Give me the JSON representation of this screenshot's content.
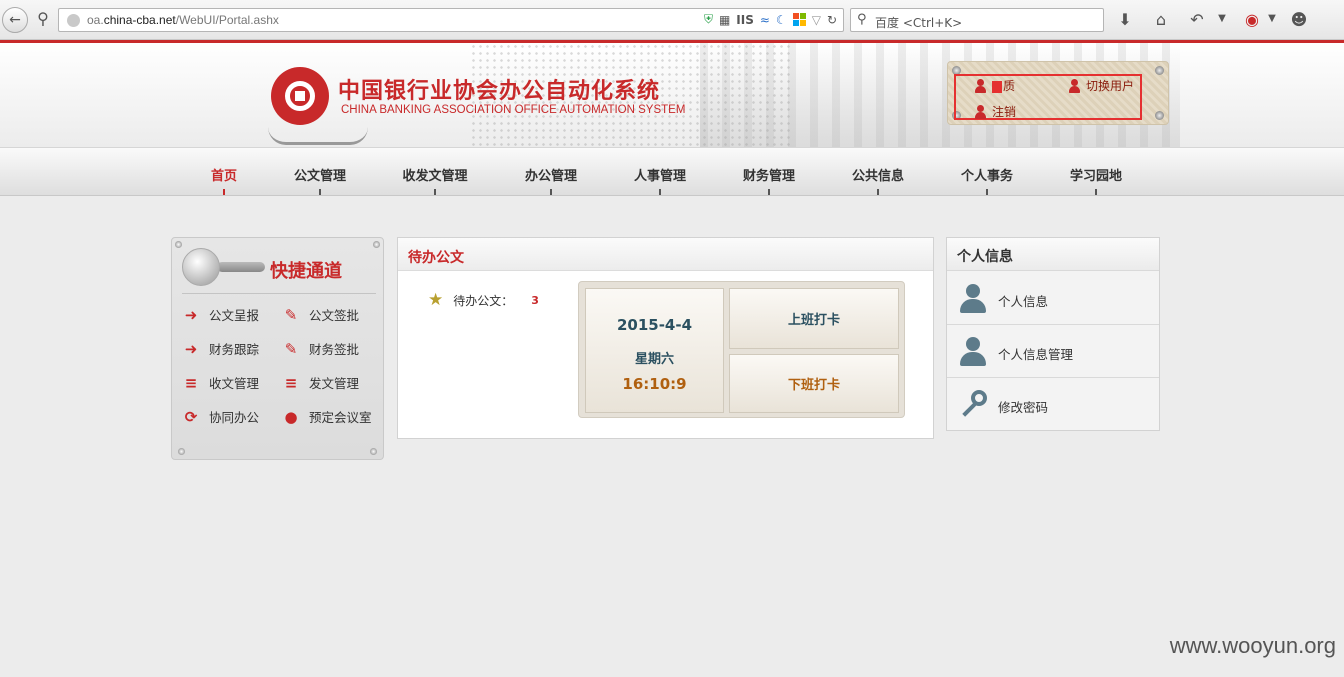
{
  "browser": {
    "url_prefix": "oa.",
    "url_domain": "china-cba.net",
    "url_path": "/WebUI/Portal.ashx",
    "search_placeholder": "百度 <Ctrl+K>",
    "iis_label": "IIS"
  },
  "header": {
    "title_cn": "中国银行业协会办公自动化系统",
    "title_en": "CHINA BANKING ASSOCIATION  OFFICE AUTOMATION SYSTEM",
    "user_name_suffix": "质",
    "switch_user": "切换用户",
    "logout": "注销"
  },
  "nav": {
    "items": [
      "首页",
      "公文管理",
      "收发文管理",
      "办公管理",
      "人事管理",
      "财务管理",
      "公共信息",
      "个人事务",
      "学习园地"
    ],
    "active_index": 0
  },
  "quick": {
    "title": "快捷通道",
    "links": [
      {
        "label": "公文呈报",
        "icon": "submit-icon"
      },
      {
        "label": "公文签批",
        "icon": "pen-icon"
      },
      {
        "label": "财务跟踪",
        "icon": "submit-icon"
      },
      {
        "label": "财务签批",
        "icon": "pen-icon"
      },
      {
        "label": "收文管理",
        "icon": "list-icon"
      },
      {
        "label": "发文管理",
        "icon": "list-icon"
      },
      {
        "label": "协同办公",
        "icon": "sync-icon"
      },
      {
        "label": "预定会议室",
        "icon": "location-pin-icon"
      }
    ]
  },
  "pending": {
    "title": "待办公文",
    "label": "待办公文：",
    "count": "3",
    "date": "2015-4-4",
    "weekday": "星期六",
    "time": "16:10:9",
    "clock_in": "上班打卡",
    "clock_out": "下班打卡"
  },
  "personal": {
    "title": "个人信息",
    "items": [
      "个人信息",
      "个人信息管理",
      "修改密码"
    ]
  },
  "watermark": "www.wooyun.org",
  "colors": {
    "accent": "#c8292a",
    "date_blue": "#2b5060",
    "time_orange": "#b06010"
  }
}
